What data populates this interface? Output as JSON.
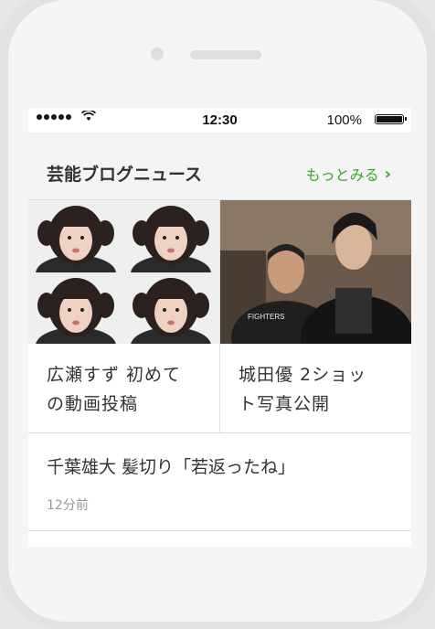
{
  "status_bar": {
    "time": "12:30",
    "battery": "100%"
  },
  "section": {
    "title": "芸能ブログニュース",
    "more_label": "もっとみる"
  },
  "cards": [
    {
      "title_line1": "広瀬すず 初めて",
      "title_line2": "の動画投稿",
      "image": "photo-grid-girl"
    },
    {
      "title_line1": "城田優 2ショッ",
      "title_line2": "ト写真公開",
      "image": "photo-two-men"
    }
  ],
  "list": [
    {
      "title": "千葉雄大 髪切り「若返ったね」",
      "time": "12分前"
    }
  ],
  "colors": {
    "accent": "#3aa629",
    "header_bg": "#f4f4f4"
  }
}
